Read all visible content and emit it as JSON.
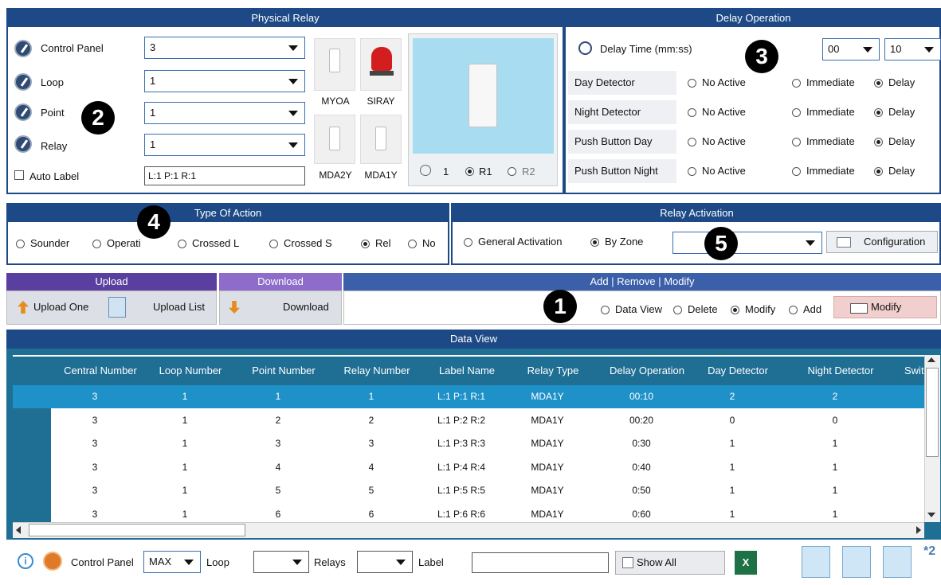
{
  "physical_relay": {
    "title": "Physical Relay",
    "control_panel_label": "Control Panel",
    "control_panel_value": "3",
    "loop_label": "Loop",
    "loop_value": "1",
    "point_label": "Point",
    "point_value": "1",
    "relay_label": "Relay",
    "relay_value": "1",
    "auto_label": "Auto Label",
    "label_value": "L:1 P:1 R:1",
    "devices": [
      "MYOA",
      "SIRAY",
      "MDA2Y",
      "MDA1Y"
    ],
    "preview_num": "1",
    "r1": "R1",
    "r2": "R2"
  },
  "delay_operation": {
    "title": "Delay Operation",
    "delay_time_label": "Delay Time (mm:ss)",
    "minutes": "00",
    "seconds": "10",
    "rows": [
      {
        "label": "Day Detector"
      },
      {
        "label": "Night Detector"
      },
      {
        "label": "Push Button Day"
      },
      {
        "label": "Push Button Night"
      }
    ],
    "opt_no_active": "No Active",
    "opt_immediate": "Immediate",
    "opt_delay": "Delay"
  },
  "type_of_action": {
    "title": "Type Of Action",
    "options": [
      "Sounder",
      "Operati",
      "Crossed L",
      "Crossed S",
      "Rel",
      "No"
    ]
  },
  "relay_activation": {
    "title": "Relay Activation",
    "general": "General Activation",
    "by_zone": "By Zone",
    "configuration": "Configuration"
  },
  "upload": {
    "title": "Upload",
    "upload_one": "Upload One",
    "upload_list": "Upload List"
  },
  "download": {
    "title": "Download",
    "download": "Download"
  },
  "modify": {
    "title": "Add | Remove | Modify",
    "data_view": "Data View",
    "delete": "Delete",
    "modify": "Modify",
    "add": "Add",
    "modify_button": "Modify"
  },
  "badges": {
    "b1": "1",
    "b2": "2",
    "b3": "3",
    "b4": "4",
    "b5": "5"
  },
  "data_view": {
    "title": "Data View",
    "columns": [
      "Central Number",
      "Loop Number",
      "Point Number",
      "Relay Number",
      "Label Name",
      "Relay Type",
      "Delay Operation",
      "Day Detector",
      "Night Detector",
      "Switc"
    ],
    "rows": [
      [
        "3",
        "1",
        "1",
        "1",
        "L:1 P:1 R:1",
        "MDA1Y",
        "00:10",
        "2",
        "2"
      ],
      [
        "3",
        "1",
        "2",
        "2",
        "L:1 P:2 R:2",
        "MDA1Y",
        "00:20",
        "0",
        "0"
      ],
      [
        "3",
        "1",
        "3",
        "3",
        "L:1 P:3 R:3",
        "MDA1Y",
        "0:30",
        "1",
        "1"
      ],
      [
        "3",
        "1",
        "4",
        "4",
        "L:1 P:4 R:4",
        "MDA1Y",
        "0:40",
        "1",
        "1"
      ],
      [
        "3",
        "1",
        "5",
        "5",
        "L:1 P:5 R:5",
        "MDA1Y",
        "0:50",
        "1",
        "1"
      ],
      [
        "3",
        "1",
        "6",
        "6",
        "L:1 P:6 R:6",
        "MDA1Y",
        "0:60",
        "1",
        "1"
      ]
    ]
  },
  "footer": {
    "control_panel": "Control Panel",
    "cp_value": "MAX",
    "loop": "Loop",
    "relays": "Relays",
    "label": "Label",
    "show_all": "Show All",
    "corner": "*2"
  },
  "colors": {
    "header": "#1d4a86",
    "selected_row": "#1f91c9",
    "upload_bar": "#5a3fa0",
    "download_bar": "#8e6cc9"
  }
}
